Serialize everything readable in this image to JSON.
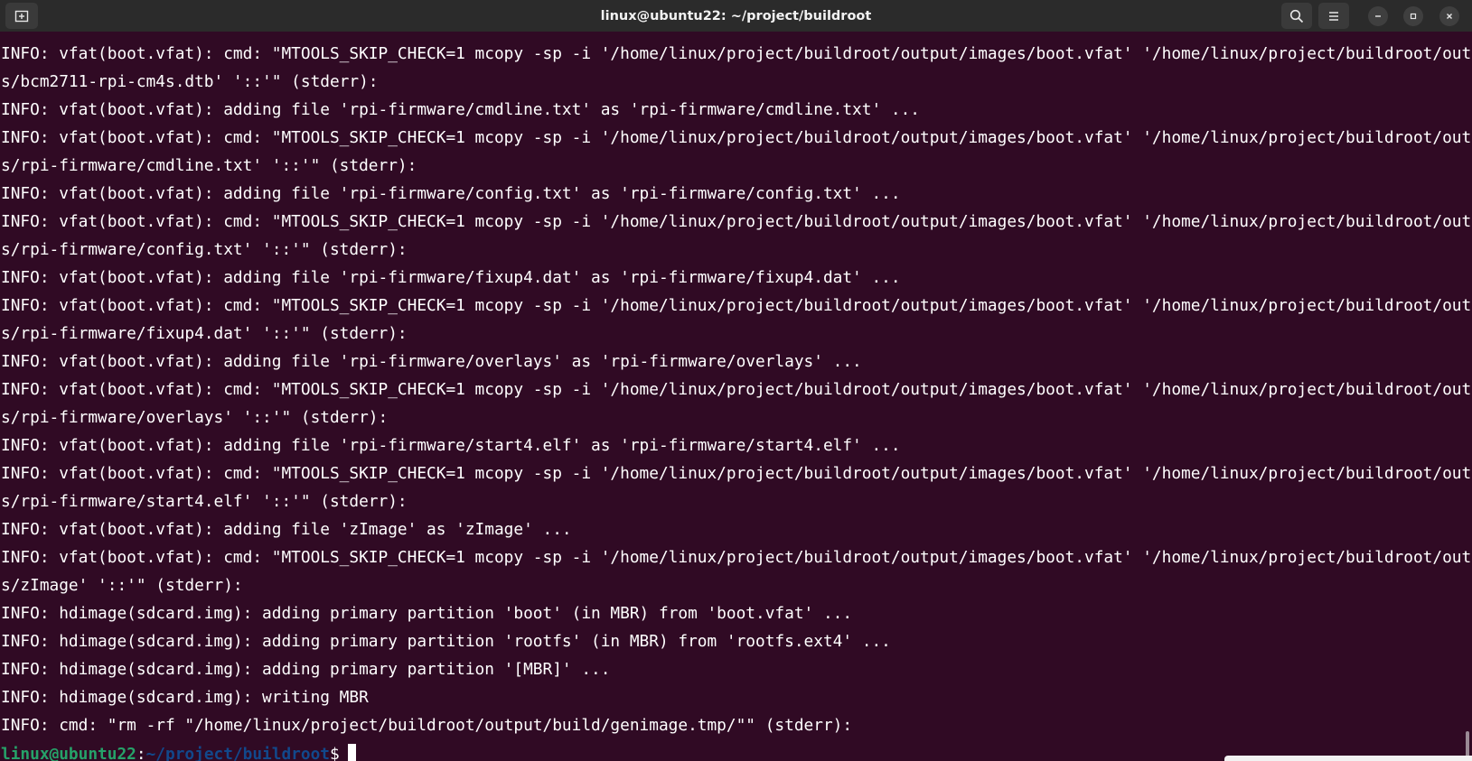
{
  "window": {
    "title": "linux@ubuntu22: ~/project/buildroot",
    "buttons": {
      "new_tab_icon": "new-tab-icon",
      "search_icon": "search-icon",
      "menu_icon": "hamburger-menu-icon",
      "minimize_icon": "minimize-icon",
      "maximize_icon": "maximize-icon",
      "close_icon": "close-icon"
    }
  },
  "terminal": {
    "lines": [
      "INFO: vfat(boot.vfat): cmd: \"MTOOLS_SKIP_CHECK=1 mcopy -sp -i '/home/linux/project/buildroot/output/images/boot.vfat' '/home/linux/project/buildroot/output/image",
      "s/bcm2711-rpi-cm4s.dtb' '::'\" (stderr):",
      "INFO: vfat(boot.vfat): adding file 'rpi-firmware/cmdline.txt' as 'rpi-firmware/cmdline.txt' ...",
      "INFO: vfat(boot.vfat): cmd: \"MTOOLS_SKIP_CHECK=1 mcopy -sp -i '/home/linux/project/buildroot/output/images/boot.vfat' '/home/linux/project/buildroot/output/image",
      "s/rpi-firmware/cmdline.txt' '::'\" (stderr):",
      "INFO: vfat(boot.vfat): adding file 'rpi-firmware/config.txt' as 'rpi-firmware/config.txt' ...",
      "INFO: vfat(boot.vfat): cmd: \"MTOOLS_SKIP_CHECK=1 mcopy -sp -i '/home/linux/project/buildroot/output/images/boot.vfat' '/home/linux/project/buildroot/output/image",
      "s/rpi-firmware/config.txt' '::'\" (stderr):",
      "INFO: vfat(boot.vfat): adding file 'rpi-firmware/fixup4.dat' as 'rpi-firmware/fixup4.dat' ...",
      "INFO: vfat(boot.vfat): cmd: \"MTOOLS_SKIP_CHECK=1 mcopy -sp -i '/home/linux/project/buildroot/output/images/boot.vfat' '/home/linux/project/buildroot/output/image",
      "s/rpi-firmware/fixup4.dat' '::'\" (stderr):",
      "INFO: vfat(boot.vfat): adding file 'rpi-firmware/overlays' as 'rpi-firmware/overlays' ...",
      "INFO: vfat(boot.vfat): cmd: \"MTOOLS_SKIP_CHECK=1 mcopy -sp -i '/home/linux/project/buildroot/output/images/boot.vfat' '/home/linux/project/buildroot/output/image",
      "s/rpi-firmware/overlays' '::'\" (stderr):",
      "INFO: vfat(boot.vfat): adding file 'rpi-firmware/start4.elf' as 'rpi-firmware/start4.elf' ...",
      "INFO: vfat(boot.vfat): cmd: \"MTOOLS_SKIP_CHECK=1 mcopy -sp -i '/home/linux/project/buildroot/output/images/boot.vfat' '/home/linux/project/buildroot/output/image",
      "s/rpi-firmware/start4.elf' '::'\" (stderr):",
      "INFO: vfat(boot.vfat): adding file 'zImage' as 'zImage' ...",
      "INFO: vfat(boot.vfat): cmd: \"MTOOLS_SKIP_CHECK=1 mcopy -sp -i '/home/linux/project/buildroot/output/images/boot.vfat' '/home/linux/project/buildroot/output/image",
      "s/zImage' '::'\" (stderr):",
      "INFO: hdimage(sdcard.img): adding primary partition 'boot' (in MBR) from 'boot.vfat' ...",
      "INFO: hdimage(sdcard.img): adding primary partition 'rootfs' (in MBR) from 'rootfs.ext4' ...",
      "INFO: hdimage(sdcard.img): adding primary partition '[MBR]' ...",
      "INFO: hdimage(sdcard.img): writing MBR",
      "INFO: cmd: \"rm -rf \"/home/linux/project/buildroot/output/build/genimage.tmp/\"\" (stderr):"
    ],
    "prompt": {
      "user_host": "linux@ubuntu22",
      "separator": ":",
      "path": "~/project/buildroot",
      "symbol": "$"
    }
  },
  "colors": {
    "terminal_bg": "#300a24",
    "titlebar_bg": "#2b2b2b",
    "prompt_user": "#26a269",
    "prompt_path": "#12488b",
    "text": "#ffffff"
  }
}
